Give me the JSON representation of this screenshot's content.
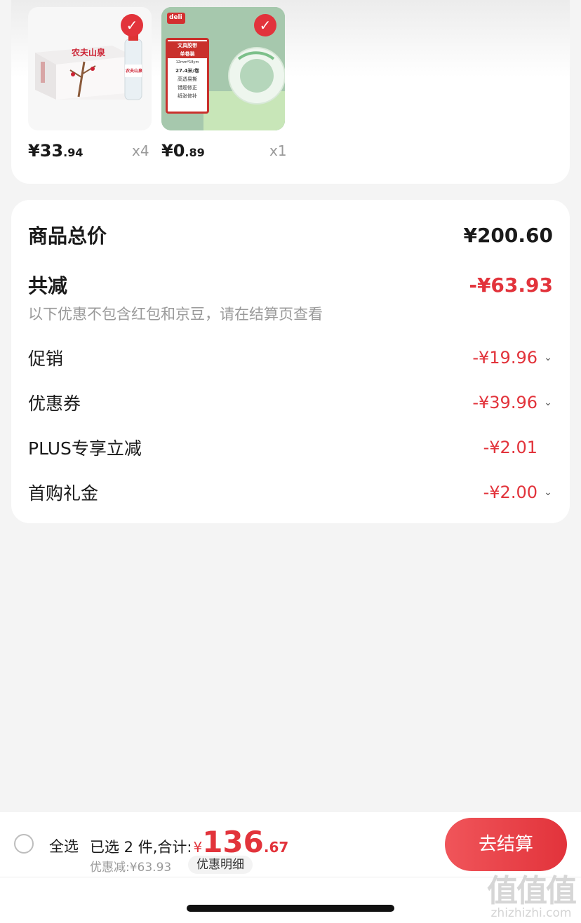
{
  "products": [
    {
      "price_main": "¥33",
      "price_dec": ".94",
      "qty": "x4",
      "image": "water-case-image",
      "box_text": "农夫山泉",
      "bottle_text": "农夫山泉"
    },
    {
      "price_main": "¥0",
      "price_dec": ".89",
      "qty": "x1",
      "image": "tape-image",
      "brand": "deli",
      "tape_lines": [
        "文具胶带",
        "单卷装",
        "12mm*18ym",
        "27.4米/卷",
        "高透易撕",
        "错题修正",
        "纸张修补"
      ]
    }
  ],
  "summary": {
    "total_label": "商品总价",
    "total_value": "¥200.60",
    "reduce_label": "共减",
    "reduce_value": "-¥63.93",
    "note": "以下优惠不包含红包和京豆，请在结算页查看",
    "items": [
      {
        "label": "促销",
        "value": "-¥19.96",
        "expandable": true
      },
      {
        "label": "优惠券",
        "value": "-¥39.96",
        "expandable": true
      },
      {
        "label": "PLUS专享立减",
        "value": "-¥2.01",
        "expandable": false
      },
      {
        "label": "首购礼金",
        "value": "-¥2.00",
        "expandable": true
      }
    ]
  },
  "bottom_bar": {
    "select_all": "全选",
    "selected_text": "已选 2 件,合计:",
    "currency": "¥",
    "total_int": "136",
    "total_dec": ".67",
    "discount_text": "优惠减:¥63.93",
    "detail_button": "优惠明细",
    "checkout_button": "去结算"
  },
  "watermark": {
    "logo": "值值值",
    "url": "zhizhizhi.com"
  },
  "colors": {
    "accent": "#e2333b",
    "muted": "#9a9a9a"
  }
}
